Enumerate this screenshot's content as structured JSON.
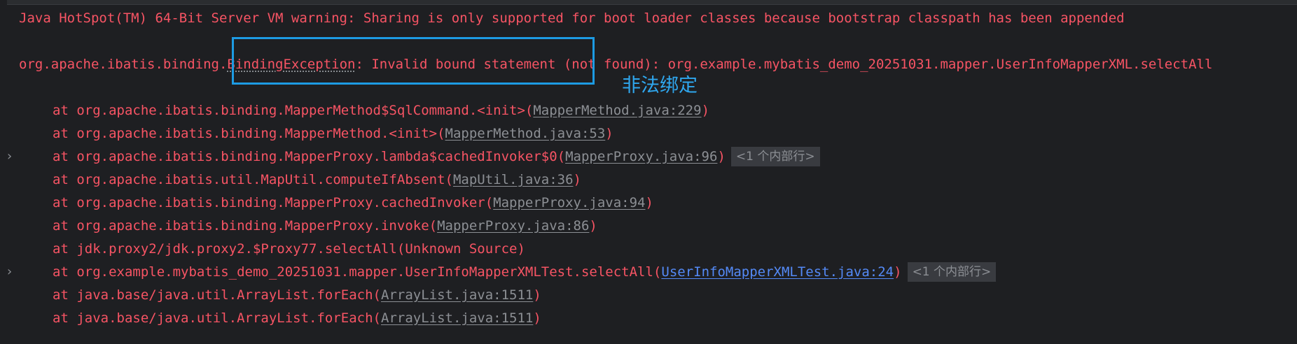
{
  "console": {
    "warning": "Java HotSpot(TM) 64-Bit Server VM warning: Sharing is only supported for boot loader classes because bootstrap classpath has been appended",
    "exception": {
      "package": "org.apache.ibatis.binding.",
      "class_name": "BindingException",
      "message": ": Invalid bound statement (not found): org.example.mybatis_demo_20251031.mapper.UserInfoMapperXML.selectAll"
    },
    "frames": [
      {
        "method": "at org.apache.ibatis.binding.MapperMethod$SqlCommand.<init>(",
        "location": "MapperMethod.java:229",
        "close": ")"
      },
      {
        "method": "at org.apache.ibatis.binding.MapperMethod.<init>(",
        "location": "MapperMethod.java:53",
        "close": ")"
      },
      {
        "method": "at org.apache.ibatis.binding.MapperProxy.lambda$cachedInvoker$0(",
        "location": "MapperProxy.java:96",
        "close": ")",
        "badge": "<1 个内部行>"
      },
      {
        "method": "at org.apache.ibatis.util.MapUtil.computeIfAbsent(",
        "location": "MapUtil.java:36",
        "close": ")"
      },
      {
        "method": "at org.apache.ibatis.binding.MapperProxy.cachedInvoker(",
        "location": "MapperProxy.java:94",
        "close": ")"
      },
      {
        "method": "at org.apache.ibatis.binding.MapperProxy.invoke(",
        "location": "MapperProxy.java:86",
        "close": ")"
      },
      {
        "method": "at jdk.proxy2/jdk.proxy2.$Proxy77.selectAll(Unknown Source)"
      },
      {
        "method": "at org.example.mybatis_demo_20251031.mapper.UserInfoMapperXMLTest.selectAll(",
        "location": "UserInfoMapperXMLTest.java:24",
        "close": ")",
        "badge": "<1 个内部行>"
      },
      {
        "method": "at java.base/java.util.ArrayList.forEach(",
        "location": "ArrayList.java:1511",
        "close": ")"
      },
      {
        "method": "at java.base/java.util.ArrayList.forEach(",
        "location": "ArrayList.java:1511",
        "close": ")"
      }
    ],
    "expand_icon": "chevron-right-icon"
  },
  "annotation": {
    "label": "非法绑定",
    "color": "#1d9be3"
  },
  "colors": {
    "background": "#1e1f22",
    "error_text": "#f75464",
    "link": "#8c8f94",
    "active_link": "#548af7",
    "badge_bg": "#393b40"
  }
}
